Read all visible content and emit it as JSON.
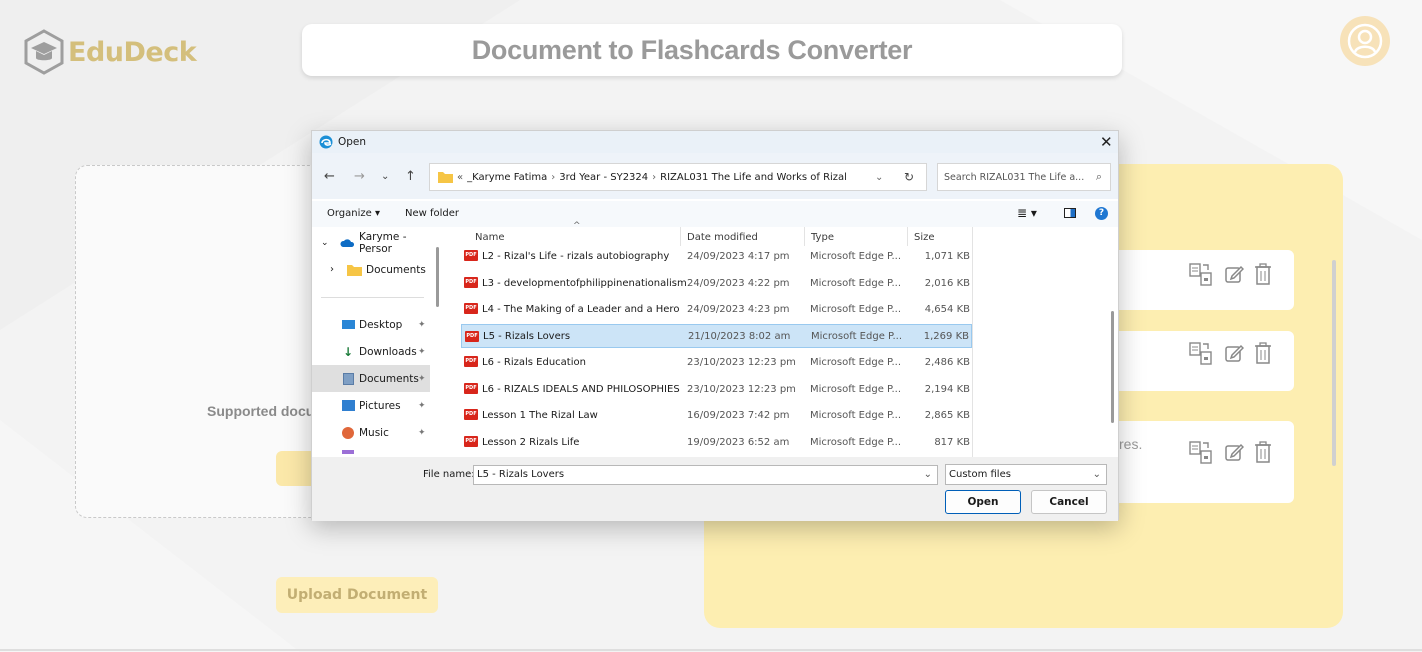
{
  "app": {
    "name": "EduDeck",
    "page_title": "Document to Flashcards Converter"
  },
  "left": {
    "supported_text": "Supported docum",
    "upload_button": "Upload Document"
  },
  "right": {
    "peek_text": "res."
  },
  "dialog": {
    "title": "Open",
    "breadcrumb": [
      "_Karyme Fatima",
      "3rd Year - SY2324",
      "RIZAL031 The Life and Works of Rizal"
    ],
    "search_placeholder": "Search RIZAL031 The Life a...",
    "organize": "Organize",
    "new_folder": "New folder",
    "nav": {
      "onedrive": "Karyme - Persor",
      "documents_sub": "Documents",
      "desktop": "Desktop",
      "downloads": "Downloads",
      "documents": "Documents",
      "pictures": "Pictures",
      "music": "Music"
    },
    "columns": {
      "name": "Name",
      "date": "Date modified",
      "type": "Type",
      "size": "Size"
    },
    "files": [
      {
        "name": "L2 - Rizal's Life - rizals autobiography",
        "date": "24/09/2023 4:17 pm",
        "type": "Microsoft Edge P...",
        "size": "1,071 KB"
      },
      {
        "name": "L3 - developmentofphilippinenationalism",
        "date": "24/09/2023 4:22 pm",
        "type": "Microsoft Edge P...",
        "size": "2,016 KB"
      },
      {
        "name": "L4 - The Making of a Leader and a Hero",
        "date": "24/09/2023 4:23 pm",
        "type": "Microsoft Edge P...",
        "size": "4,654 KB"
      },
      {
        "name": "L5 - Rizals Lovers",
        "date": "21/10/2023 8:02 am",
        "type": "Microsoft Edge P...",
        "size": "1,269 KB"
      },
      {
        "name": "L6 - Rizals Education",
        "date": "23/10/2023 12:23 pm",
        "type": "Microsoft Edge P...",
        "size": "2,486 KB"
      },
      {
        "name": "L6 - RIZALS IDEALS AND PHILOSOPHIES",
        "date": "23/10/2023 12:23 pm",
        "type": "Microsoft Edge P...",
        "size": "2,194 KB"
      },
      {
        "name": "Lesson 1 The Rizal Law",
        "date": "16/09/2023 7:42 pm",
        "type": "Microsoft Edge P...",
        "size": "2,865 KB"
      },
      {
        "name": "Lesson 2 Rizals Life",
        "date": "19/09/2023 6:52 am",
        "type": "Microsoft Edge P...",
        "size": "817 KB"
      }
    ],
    "selected_index": 3,
    "file_name_label": "File name:",
    "file_name_value": "L5 - Rizals Lovers",
    "file_type": "Custom files",
    "open_button": "Open",
    "cancel_button": "Cancel"
  },
  "colors": {
    "brand": "#d4bf7c",
    "panel": "#fdeeb1",
    "button": "#fdeeb9",
    "selection": "#cce4f7"
  }
}
